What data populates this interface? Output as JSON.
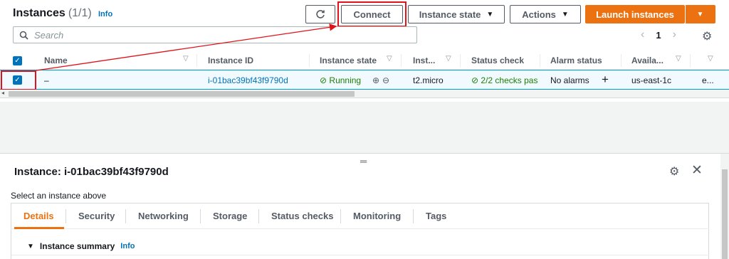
{
  "header": {
    "title": "Instances",
    "count": "(1/1)",
    "info": "Info",
    "refresh_icon": "refresh-icon",
    "connect_label": "Connect",
    "instance_state_label": "Instance state",
    "actions_label": "Actions",
    "launch_label": "Launch instances"
  },
  "search": {
    "placeholder": "Search",
    "icon": "search-icon"
  },
  "pagination": {
    "page": "1",
    "prev_icon": "chevron-left-icon",
    "next_icon": "chevron-right-icon"
  },
  "table": {
    "columns": [
      "Name",
      "Instance ID",
      "Instance state",
      "Inst...",
      "Status check",
      "Alarm status",
      "Availa..."
    ],
    "row": {
      "name": "–",
      "instance_id": "i-01bac39bf43f9790d",
      "state": "Running",
      "type": "t2.micro",
      "status_check": "2/2 checks pas",
      "alarm": "No alarms",
      "az": "us-east-1c",
      "extra": "e..."
    }
  },
  "details": {
    "title": "Instance: i-01bac39bf43f9790d",
    "subtitle": "Select an instance above",
    "tabs": [
      "Details",
      "Security",
      "Networking",
      "Storage",
      "Status checks",
      "Monitoring",
      "Tags"
    ],
    "section_title": "Instance summary",
    "section_info": "Info"
  },
  "colors": {
    "accent": "#ec7211",
    "link": "#0073bb",
    "highlight": "#e0121a",
    "success": "#1d8102"
  }
}
